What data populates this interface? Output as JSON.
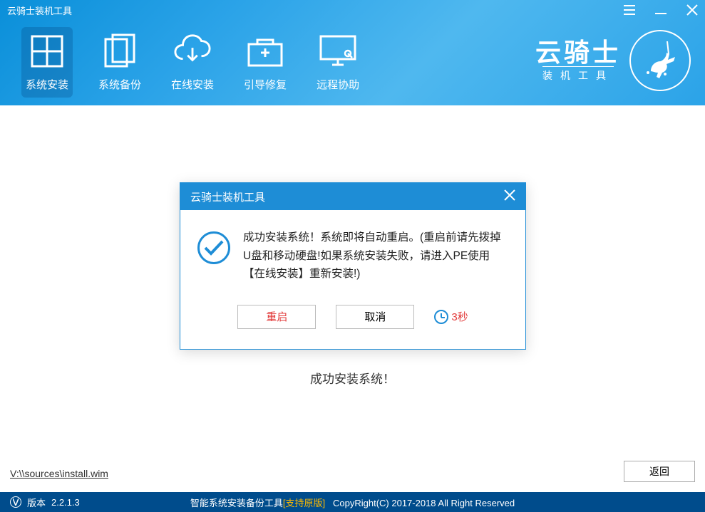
{
  "app_title": "云骑士装机工具",
  "window": {
    "minimize": "−",
    "close": "×"
  },
  "toolbar": [
    {
      "label": "系统安装",
      "icon": "windows"
    },
    {
      "label": "系统备份",
      "icon": "copy"
    },
    {
      "label": "在线安装",
      "icon": "cloud-download"
    },
    {
      "label": "引导修复",
      "icon": "toolbox"
    },
    {
      "label": "远程协助",
      "icon": "monitor"
    }
  ],
  "brand": {
    "title": "云骑士",
    "subtitle": "装机工具"
  },
  "dialog": {
    "title": "云骑士装机工具",
    "message": "成功安装系统！系统即将自动重启。(重启前请先拨掉U盘和移动硬盘!如果系统安装失败，请进入PE使用【在线安装】重新安装!)",
    "restart_btn": "重启",
    "cancel_btn": "取消",
    "countdown": "3秒"
  },
  "main_status": "成功安装系统！",
  "file_path": "V:\\\\sources\\install.wim",
  "back_btn": "返回",
  "footer": {
    "version_prefix": "版本",
    "version": "2.2.1.3",
    "center_plain": "智能系统安装备份工具",
    "center_gold": "[支持原版]",
    "copyright": "CopyRight(C) 2017-2018 All Right Reserved"
  }
}
